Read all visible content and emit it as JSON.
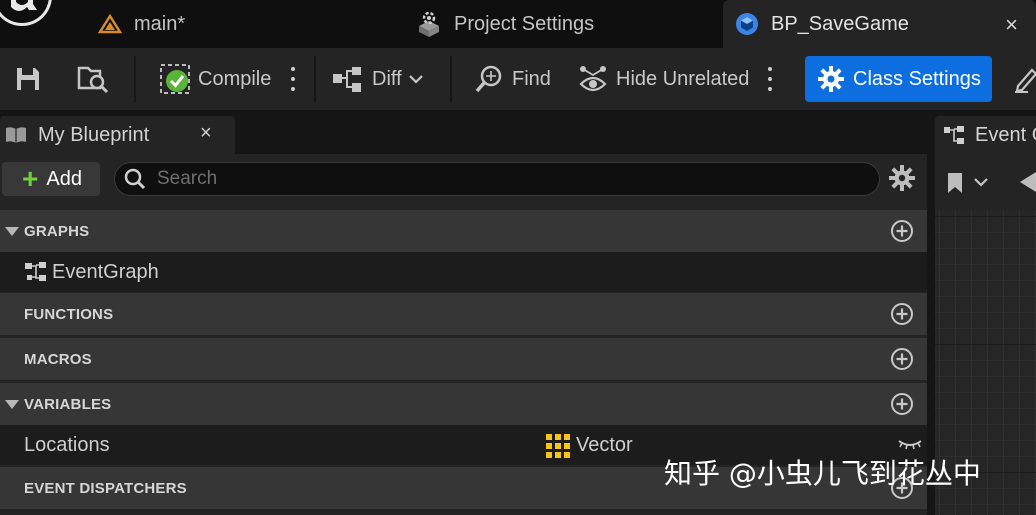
{
  "tabs": [
    {
      "label": "main*",
      "icon": "ue-level-icon"
    },
    {
      "label": "Project Settings",
      "icon": "settings-cube-icon"
    },
    {
      "label": "BP_SaveGame",
      "icon": "blueprint-class-icon",
      "active": true,
      "close": "×"
    }
  ],
  "toolbar": {
    "save_icon": "save-icon",
    "browse_icon": "browse-icon",
    "compile_label": "Compile",
    "diff_label": "Diff",
    "find_label": "Find",
    "hide_unrelated_label": "Hide Unrelated",
    "class_settings_label": "Class Settings"
  },
  "my_blueprint": {
    "title": "My Blueprint",
    "close": "×",
    "add_label": "Add",
    "search_placeholder": "Search",
    "sections": {
      "graphs": "GRAPHS",
      "functions": "FUNCTIONS",
      "macros": "MACROS",
      "variables": "VARIABLES",
      "event_dispatchers": "EVENT DISPATCHERS"
    },
    "graph_items": [
      {
        "label": "EventGraph"
      }
    ],
    "variables": [
      {
        "name": "Locations",
        "type": "Vector",
        "type_color": "#f5c518"
      }
    ]
  },
  "graph_panel": {
    "tab_label": "Event Graph"
  },
  "watermark": "知乎 @小虫儿飞到花丛中",
  "colors": {
    "accent": "#0d6ee0",
    "compile_ok": "#5ab43a",
    "vector_pin": "#f5c518"
  }
}
